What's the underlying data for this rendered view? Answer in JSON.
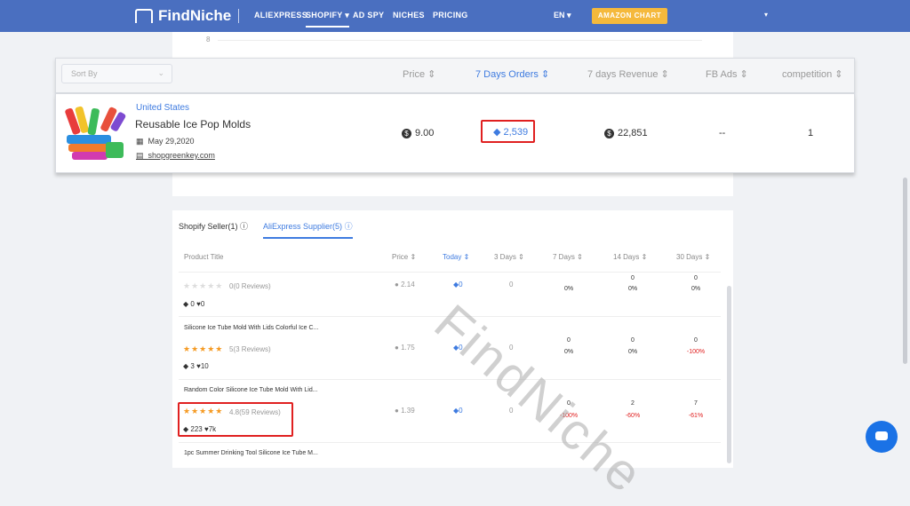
{
  "brand": "FindNiche",
  "nav": {
    "items": [
      "ALIEXPRESS",
      "SHOPIFY",
      "AD SPY",
      "NICHES",
      "PRICING"
    ],
    "shopify_caret": "▾",
    "lang": "EN ▾",
    "amazon_btn": "AMAZON CHART",
    "right_caret": "▾"
  },
  "chart": {
    "tick": "8"
  },
  "header": {
    "sort_placeholder": "Sort By",
    "cols": [
      "Price ⇕",
      "7 Days Orders ⇕",
      "7 days Revenue ⇕",
      "FB Ads ⇕",
      "competition ⇕"
    ]
  },
  "product": {
    "country": "United States",
    "title": "Reusable Ice Pop Molds",
    "date": "May 29,2020",
    "shop": "shopgreenkey.com",
    "price": "9.00",
    "orders": "2,539",
    "revenue": "22,851",
    "fb_ads": "--",
    "competition": "1"
  },
  "tabs": {
    "shopify": "Shopify Seller(1)",
    "ali": "AliExpress Supplier(5)"
  },
  "table": {
    "headers": [
      "Product Title",
      "Price ⇕",
      "Today ⇕",
      "3 Days ⇕",
      "7 Days ⇕",
      "14 Days ⇕",
      "30 Days ⇕"
    ],
    "rows": [
      {
        "title": "",
        "stars": "★★★★★",
        "rating": "0(0 Reviews)",
        "orders": "0",
        "likes": "0",
        "price": "2.14",
        "today": "0",
        "d3": "0",
        "d7": "0%",
        "d14_top": "0",
        "d14": "0%",
        "d30_top": "0",
        "d30": "0%"
      },
      {
        "title": "Silicone Ice Tube Mold With Lids Colorful Ice C...",
        "stars": "★★★★★",
        "rating": "5(3 Reviews)",
        "orders": "3",
        "likes": "10",
        "price": "1.75",
        "today": "0",
        "d3": "0",
        "d7_top": "0",
        "d7": "0%",
        "d14_top": "0",
        "d14": "0%",
        "d30_top": "0",
        "d30": "-100%"
      },
      {
        "title": "Random Color Silicone Ice Tube Mold With Lid...",
        "stars": "★★★★★",
        "rating": "4.8(59 Reviews)",
        "orders": "223",
        "likes": "7k",
        "price": "1.39",
        "today": "0",
        "d3": "0",
        "d7_top": "0",
        "d7": "-100%",
        "d14_top": "2",
        "d14": "-60%",
        "d30_top": "7",
        "d30": "-61%"
      },
      {
        "title": "1pc Summer Drinking Tool Silicone Ice Tube M..."
      }
    ]
  },
  "watermark": "FindNiche",
  "colors": {
    "nav": "#4a6fc0",
    "accent": "#3e7be0",
    "highlight": "#e02020",
    "amazon": "#f5b93c"
  }
}
